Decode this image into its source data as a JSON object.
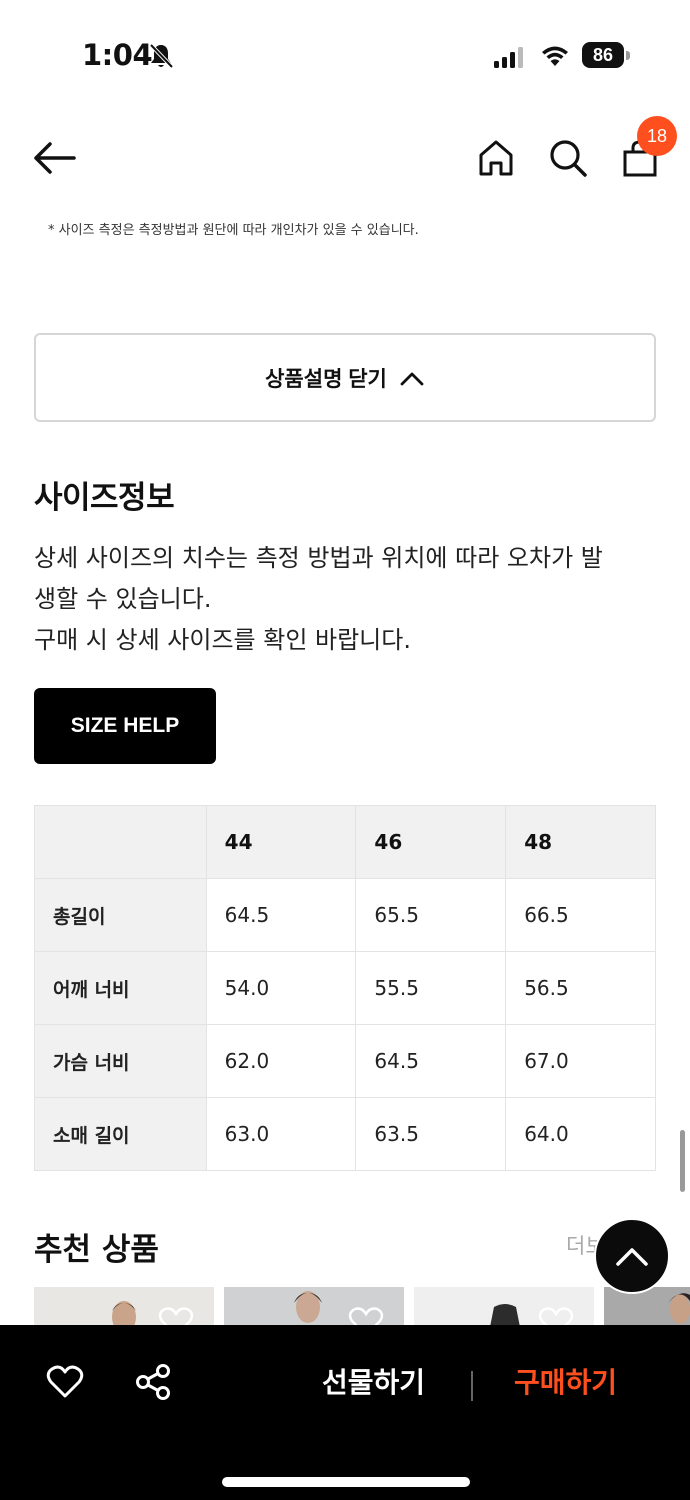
{
  "status": {
    "time": "1:04",
    "battery": "86"
  },
  "nav": {
    "cart_count": "18"
  },
  "notes": {
    "measure_note": "* 사이즈 측정은 측정방법과 원단에 따라 개인차가 있을 수 있습니다."
  },
  "description": {
    "close_label": "상품설명 닫기"
  },
  "size_info": {
    "title": "사이즈정보",
    "desc_lines": [
      "상세 사이즈의 치수는 측정 방법과 위치에 따라 오차가 발",
      "생할 수 있습니다.",
      "구매 시 상세 사이즈를 확인 바랍니다."
    ],
    "help_label": "SIZE HELP",
    "table": {
      "headers": [
        "",
        "44",
        "46",
        "48"
      ],
      "rows": [
        {
          "label": "총길이",
          "values": [
            "64.5",
            "65.5",
            "66.5"
          ]
        },
        {
          "label": "어깨 너비",
          "values": [
            "54.0",
            "55.5",
            "56.5"
          ]
        },
        {
          "label": "가슴 너비",
          "values": [
            "62.0",
            "64.5",
            "67.0"
          ]
        },
        {
          "label": "소매 길이",
          "values": [
            "63.0",
            "63.5",
            "64.0"
          ]
        }
      ]
    }
  },
  "recommend": {
    "title": "추천 상품",
    "more": "더보"
  },
  "bottom_bar": {
    "gift_label": "선물하기",
    "buy_label": "구매하기"
  },
  "colors": {
    "accent": "#ff4f1f",
    "bar_bg": "#000000"
  }
}
